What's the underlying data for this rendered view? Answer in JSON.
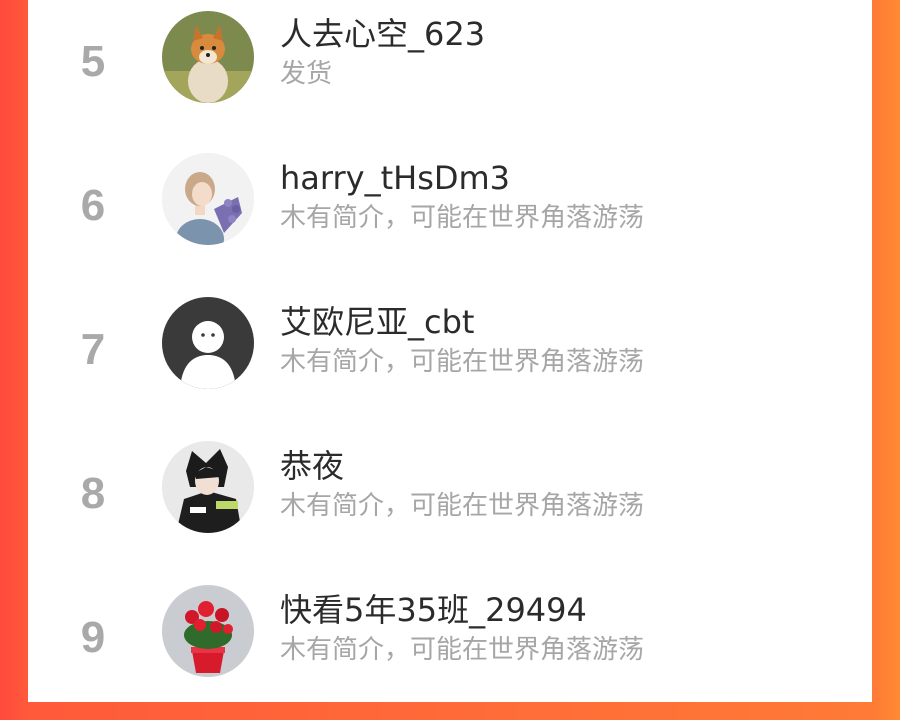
{
  "theme": {
    "accent": "#ff5a3a",
    "rank_color": "#a9a9a9",
    "bio_color": "#a6a6a6"
  },
  "list": [
    {
      "rank": "5",
      "name": "人去心空_623",
      "bio": "发货",
      "avatar": "shiba-dog"
    },
    {
      "rank": "6",
      "name": "harry_tHsDm3",
      "bio": "木有简介，可能在世界角落游荡",
      "avatar": "girl-with-lavender"
    },
    {
      "rank": "7",
      "name": "艾欧尼亚_cbt",
      "bio": "木有简介，可能在世界角落游荡",
      "avatar": "default-person"
    },
    {
      "rank": "8",
      "name": "恭夜",
      "bio": "木有简介，可能在世界角落游荡",
      "avatar": "anime-boy"
    },
    {
      "rank": "9",
      "name": "快看5年35班_29494",
      "bio": "木有简介，可能在世界角落游荡",
      "avatar": "red-flowers-pot"
    }
  ]
}
